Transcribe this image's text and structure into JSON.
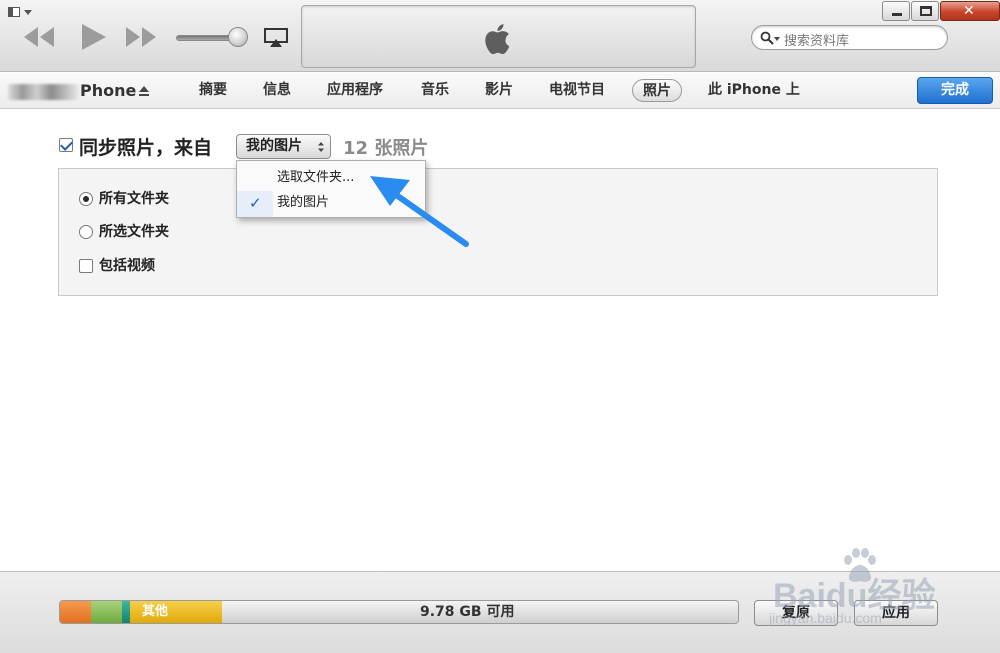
{
  "toolbar": {
    "search": {
      "placeholder": "搜索资料库",
      "icon": "search-icon"
    },
    "icons": [
      "menu-toggle-icon",
      "previous-icon",
      "play-icon",
      "next-icon",
      "volume-slider",
      "airplay-icon",
      "apple-logo-icon",
      "minimize-icon",
      "maximize-icon",
      "close-icon"
    ],
    "volume_level": 0.85
  },
  "device": {
    "name": "Phone",
    "eject_icon": "eject-icon"
  },
  "tabs": [
    {
      "label": "摘要"
    },
    {
      "label": "信息"
    },
    {
      "label": "应用程序"
    },
    {
      "label": "音乐"
    },
    {
      "label": "影片"
    },
    {
      "label": "电视节目"
    },
    {
      "label": "照片",
      "selected": true
    },
    {
      "label": "此 iPhone 上"
    }
  ],
  "done_label": "完成",
  "sync": {
    "checkbox_checked": true,
    "label": "同步照片，来自",
    "source_value": "我的图片",
    "count_text": "12 张照片"
  },
  "options": {
    "all_folders": "所有文件夹",
    "selected_folders": "所选文件夹",
    "include_videos": "包括视频",
    "selected_radio": "all_folders",
    "include_videos_checked": false
  },
  "dropdown": {
    "items": [
      {
        "label": "选取文件夹...",
        "checked": false
      },
      {
        "label": "我的图片",
        "checked": true
      }
    ],
    "check_mark": "✓"
  },
  "footer": {
    "capacity": {
      "other_label": "其他",
      "free_label": "9.78 GB 可用",
      "segment_colors": [
        "#e2701e",
        "#6faa3f",
        "#14836e",
        "#e0a90b"
      ]
    },
    "restore_label": "复原",
    "apply_label": "应用"
  },
  "watermark": {
    "text": "Baidu经验",
    "url": "jingyan.baidu.com"
  },
  "colors": {
    "accent": "#1f6fd0",
    "annotation_arrow": "#2a8cf0"
  }
}
